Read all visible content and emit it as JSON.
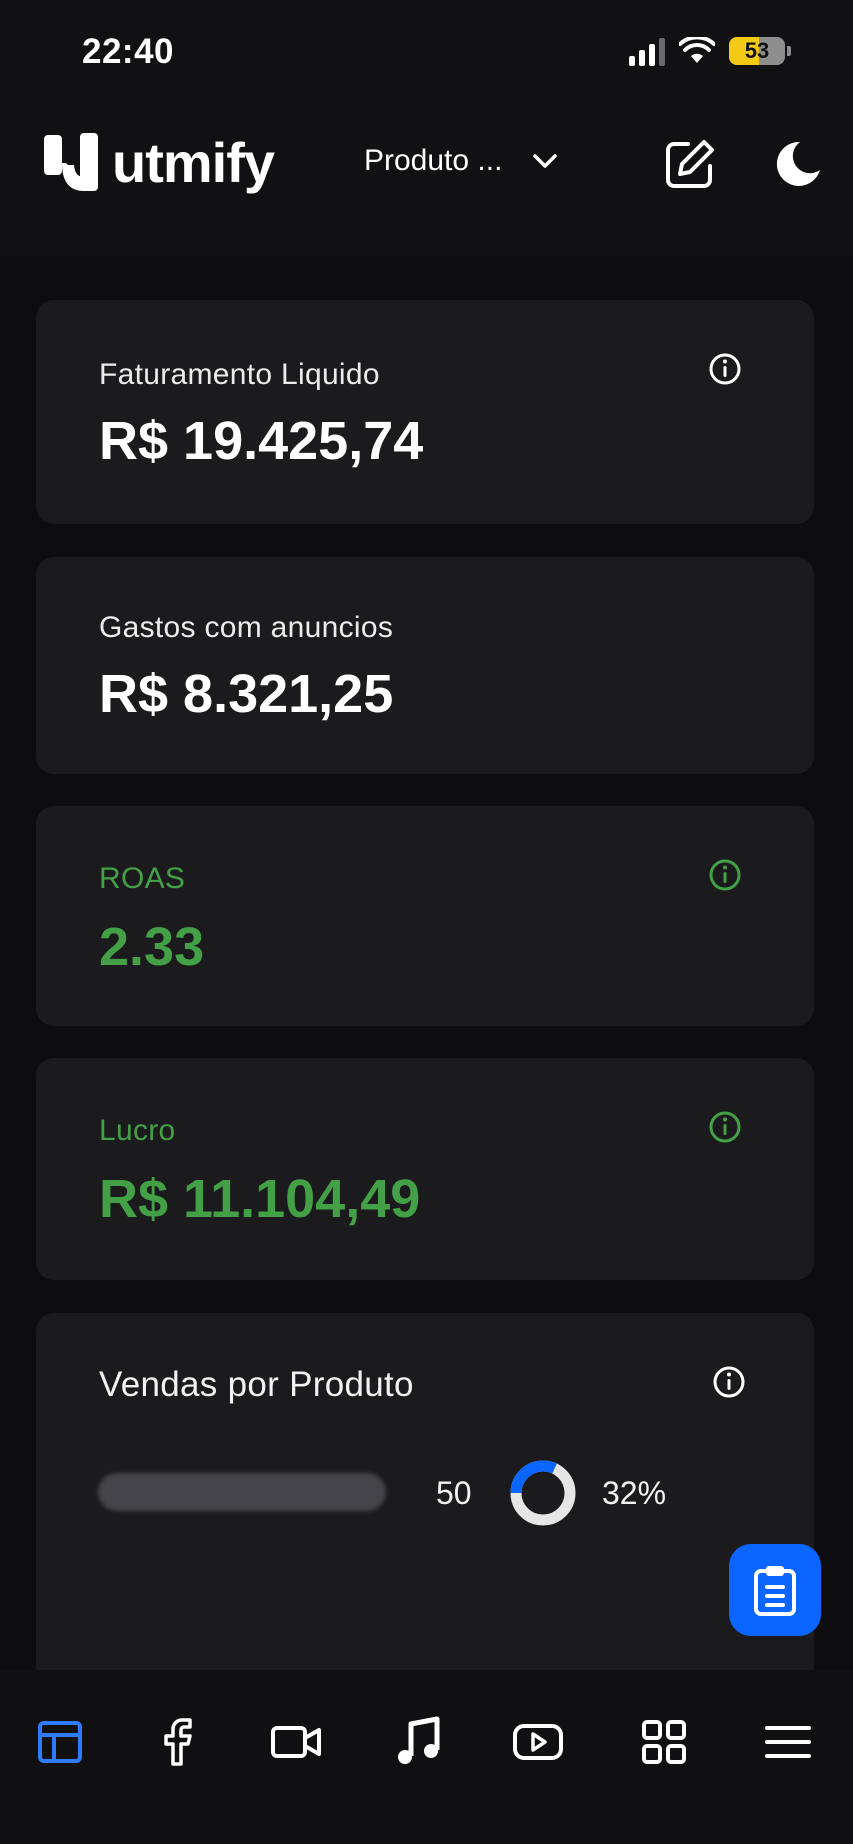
{
  "status_bar": {
    "time": "22:40",
    "battery": "53",
    "icons": [
      "signal-icon",
      "wifi-icon",
      "battery-icon"
    ]
  },
  "header": {
    "logo_text": "utmify",
    "product_select": "Produto ...",
    "icons": [
      "edit-icon",
      "moon-icon",
      "chevron-down-icon"
    ]
  },
  "cards": {
    "revenue": {
      "label": "Faturamento Liquido",
      "value": "R$ 19.425,74"
    },
    "ad_spend": {
      "label": "Gastos com anuncios",
      "value": "R$ 8.321,25"
    },
    "roas": {
      "label": "ROAS",
      "value": "2.33"
    },
    "profit": {
      "label": "Lucro",
      "value": "R$ 11.104,49"
    }
  },
  "sales_by_product": {
    "title": "Vendas por Produto",
    "rows": [
      {
        "count": "50",
        "percent": "32%",
        "share": 0.32
      }
    ]
  },
  "bottom_nav": {
    "items": [
      "dashboard-icon",
      "facebook-icon",
      "video-icon",
      "music-icon",
      "youtube-icon",
      "grid-icon",
      "menu-icon"
    ],
    "active": "dashboard-icon"
  },
  "colors": {
    "accent_blue": "#0a66ff",
    "positive_green": "#43a047",
    "card_bg": "#1b1b1d",
    "page_bg": "#0d0d0f"
  }
}
